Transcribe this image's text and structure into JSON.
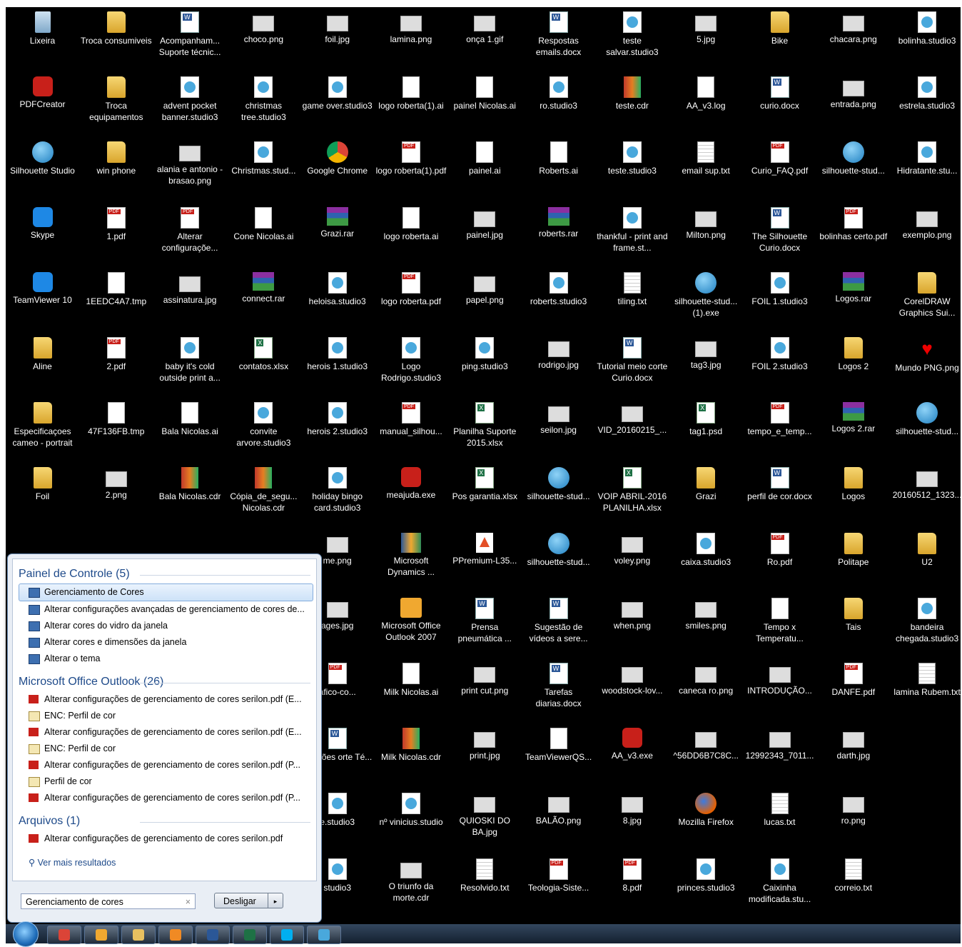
{
  "desktop": {
    "icons": [
      {
        "label": "Lixeira",
        "kind": "recycle",
        "icon": "recycle-bin-icon"
      },
      {
        "label": "Troca consumiveis",
        "kind": "folder",
        "icon": "folder-icon"
      },
      {
        "label": "Acompanham... Suporte técnic...",
        "kind": "word",
        "icon": "word-document-icon"
      },
      {
        "label": "choco.png",
        "kind": "img",
        "icon": "image-file-icon"
      },
      {
        "label": "foil.jpg",
        "kind": "img",
        "icon": "image-file-icon"
      },
      {
        "label": "lamina.png",
        "kind": "img",
        "icon": "image-file-icon"
      },
      {
        "label": "onça 1.gif",
        "kind": "img",
        "icon": "image-file-icon"
      },
      {
        "label": "Respostas emails.docx",
        "kind": "word",
        "icon": "word-document-icon"
      },
      {
        "label": "teste salvar.studio3",
        "kind": "studio",
        "icon": "studio3-file-icon"
      },
      {
        "label": "5.jpg",
        "kind": "img",
        "icon": "image-file-icon"
      },
      {
        "label": "Bike",
        "kind": "folder",
        "icon": "folder-icon"
      },
      {
        "label": "chacara.png",
        "kind": "img",
        "icon": "image-file-icon"
      },
      {
        "label": "bolinha.studio3",
        "kind": "studio",
        "icon": "studio3-file-icon"
      },
      {
        "label": "PDFCreator",
        "kind": "red",
        "icon": "pdfcreator-icon"
      },
      {
        "label": "Troca equipamentos",
        "kind": "folder",
        "icon": "folder-icon"
      },
      {
        "label": "advent pocket banner.studio3",
        "kind": "studio",
        "icon": "studio3-file-icon"
      },
      {
        "label": "christmas tree.studio3",
        "kind": "studio",
        "icon": "studio3-file-icon"
      },
      {
        "label": "game over.studio3",
        "kind": "studio",
        "icon": "studio3-file-icon"
      },
      {
        "label": "logo roberta(1).ai",
        "kind": "doc",
        "icon": "blank-file-icon"
      },
      {
        "label": "painel Nicolas.ai",
        "kind": "doc",
        "icon": "blank-file-icon"
      },
      {
        "label": "ro.studio3",
        "kind": "studio",
        "icon": "studio3-file-icon"
      },
      {
        "label": "teste.cdr",
        "kind": "cdr",
        "icon": "coreldraw-file-icon"
      },
      {
        "label": "AA_v3.log",
        "kind": "log",
        "icon": "log-file-icon"
      },
      {
        "label": "curio.docx",
        "kind": "word",
        "icon": "word-document-icon"
      },
      {
        "label": "entrada.png",
        "kind": "img",
        "icon": "image-file-icon"
      },
      {
        "label": "estrela.studio3",
        "kind": "studio",
        "icon": "studio3-file-icon"
      },
      {
        "label": "Silhouette Studio",
        "kind": "silh",
        "icon": "silhouette-studio-icon"
      },
      {
        "label": "win phone",
        "kind": "folder",
        "icon": "folder-icon"
      },
      {
        "label": "alania e antonio - brasao.png",
        "kind": "img",
        "icon": "image-file-icon"
      },
      {
        "label": "Christmas.stud...",
        "kind": "studio",
        "icon": "studio3-file-icon"
      },
      {
        "label": "Google Chrome",
        "kind": "chrome",
        "icon": "chrome-icon"
      },
      {
        "label": "logo roberta(1).pdf",
        "kind": "pdf",
        "icon": "pdf-file-icon"
      },
      {
        "label": "painel.ai",
        "kind": "doc",
        "icon": "blank-file-icon"
      },
      {
        "label": "Roberts.ai",
        "kind": "doc",
        "icon": "blank-file-icon"
      },
      {
        "label": "teste.studio3",
        "kind": "studio",
        "icon": "studio3-file-icon"
      },
      {
        "label": "email sup.txt",
        "kind": "txt",
        "icon": "text-file-icon"
      },
      {
        "label": "Curio_FAQ.pdf",
        "kind": "pdf",
        "icon": "pdf-file-icon"
      },
      {
        "label": "silhouette-stud...",
        "kind": "silh",
        "icon": "silhouette-studio-icon"
      },
      {
        "label": "Hidratante.stu...",
        "kind": "studio",
        "icon": "studio3-file-icon"
      },
      {
        "label": "Skype",
        "kind": "blue",
        "icon": "skype-icon"
      },
      {
        "label": "1.pdf",
        "kind": "pdf",
        "icon": "pdf-file-icon"
      },
      {
        "label": "Alterar configuraçõe...",
        "kind": "pdf",
        "icon": "pdf-file-icon"
      },
      {
        "label": "Cone Nicolas.ai",
        "kind": "doc",
        "icon": "blank-file-icon"
      },
      {
        "label": "Grazi.rar",
        "kind": "rar",
        "icon": "winrar-archive-icon"
      },
      {
        "label": "logo roberta.ai",
        "kind": "doc",
        "icon": "blank-file-icon"
      },
      {
        "label": "painel.jpg",
        "kind": "img",
        "icon": "image-file-icon"
      },
      {
        "label": "roberts.rar",
        "kind": "rar",
        "icon": "winrar-archive-icon"
      },
      {
        "label": "thankful - print and frame.st...",
        "kind": "studio",
        "icon": "studio3-file-icon"
      },
      {
        "label": "Milton.png",
        "kind": "img",
        "icon": "image-file-icon"
      },
      {
        "label": "The Silhouette Curio.docx",
        "kind": "word",
        "icon": "word-document-icon"
      },
      {
        "label": "bolinhas certo.pdf",
        "kind": "pdf",
        "icon": "pdf-file-icon"
      },
      {
        "label": "exemplo.png",
        "kind": "img",
        "icon": "image-file-icon"
      },
      {
        "label": "TeamViewer 10",
        "kind": "blue",
        "icon": "teamviewer-icon"
      },
      {
        "label": "1EEDC4A7.tmp",
        "kind": "doc",
        "icon": "blank-file-icon"
      },
      {
        "label": "assinatura.jpg",
        "kind": "img",
        "icon": "image-file-icon"
      },
      {
        "label": "connect.rar",
        "kind": "rar",
        "icon": "winrar-archive-icon"
      },
      {
        "label": "heloisa.studio3",
        "kind": "studio",
        "icon": "studio3-file-icon"
      },
      {
        "label": "logo roberta.pdf",
        "kind": "pdf",
        "icon": "pdf-file-icon"
      },
      {
        "label": "papel.png",
        "kind": "img",
        "icon": "image-file-icon"
      },
      {
        "label": "roberts.studio3",
        "kind": "studio",
        "icon": "studio3-file-icon"
      },
      {
        "label": "tiling.txt",
        "kind": "txt",
        "icon": "text-file-icon"
      },
      {
        "label": "silhouette-stud... (1).exe",
        "kind": "silh",
        "icon": "silhouette-studio-icon"
      },
      {
        "label": "FOIL 1.studio3",
        "kind": "studio",
        "icon": "studio3-file-icon"
      },
      {
        "label": "Logos.rar",
        "kind": "rar",
        "icon": "winrar-archive-icon"
      },
      {
        "label": "CorelDRAW Graphics Sui...",
        "kind": "folder",
        "icon": "folder-icon"
      },
      {
        "label": "Aline",
        "kind": "folder",
        "icon": "folder-icon"
      },
      {
        "label": "2.pdf",
        "kind": "pdf",
        "icon": "pdf-file-icon"
      },
      {
        "label": "baby it's cold outside print a...",
        "kind": "studio",
        "icon": "studio3-file-icon"
      },
      {
        "label": "contatos.xlsx",
        "kind": "excel",
        "icon": "excel-file-icon"
      },
      {
        "label": "herois 1.studio3",
        "kind": "studio",
        "icon": "studio3-file-icon"
      },
      {
        "label": "Logo Rodrigo.studio3",
        "kind": "studio",
        "icon": "studio3-file-icon"
      },
      {
        "label": "ping.studio3",
        "kind": "studio",
        "icon": "studio3-file-icon"
      },
      {
        "label": "rodrigo.jpg",
        "kind": "img",
        "icon": "image-file-icon"
      },
      {
        "label": "Tutorial meio corte Curio.docx",
        "kind": "word",
        "icon": "word-document-icon"
      },
      {
        "label": "tag3.jpg",
        "kind": "img",
        "icon": "image-file-icon"
      },
      {
        "label": "FOIL 2.studio3",
        "kind": "studio",
        "icon": "studio3-file-icon"
      },
      {
        "label": "Logos 2",
        "kind": "folder",
        "icon": "folder-icon"
      },
      {
        "label": "Mundo PNG.png",
        "kind": "heart",
        "icon": "heart-icon"
      },
      {
        "label": "Especificaçoes cameo - portrait",
        "kind": "folder",
        "icon": "folder-icon"
      },
      {
        "label": "47F136FB.tmp",
        "kind": "doc",
        "icon": "blank-file-icon"
      },
      {
        "label": "Bala Nicolas.ai",
        "kind": "doc",
        "icon": "blank-file-icon"
      },
      {
        "label": "convite arvore.studio3",
        "kind": "studio",
        "icon": "studio3-file-icon"
      },
      {
        "label": "herois 2.studio3",
        "kind": "studio",
        "icon": "studio3-file-icon"
      },
      {
        "label": "manual_silhou...",
        "kind": "pdf",
        "icon": "pdf-file-icon"
      },
      {
        "label": "Planilha Suporte 2015.xlsx",
        "kind": "excel",
        "icon": "excel-file-icon"
      },
      {
        "label": "seilon.jpg",
        "kind": "img",
        "icon": "image-file-icon"
      },
      {
        "label": "VID_20160215_...",
        "kind": "img",
        "icon": "video-file-icon"
      },
      {
        "label": "tag1.psd",
        "kind": "excel",
        "icon": "psd-file-icon"
      },
      {
        "label": "tempo_e_temp...",
        "kind": "pdf",
        "icon": "pdf-file-icon"
      },
      {
        "label": "Logos 2.rar",
        "kind": "rar",
        "icon": "winrar-archive-icon"
      },
      {
        "label": "silhouette-stud...",
        "kind": "silh",
        "icon": "silhouette-studio-icon"
      },
      {
        "label": "Foil",
        "kind": "folder",
        "icon": "folder-icon"
      },
      {
        "label": "2.png",
        "kind": "img",
        "icon": "image-file-icon"
      },
      {
        "label": "Bala Nicolas.cdr",
        "kind": "cdr",
        "icon": "coreldraw-file-icon"
      },
      {
        "label": "Cópia_de_segu... Nicolas.cdr",
        "kind": "cdr",
        "icon": "coreldraw-file-icon"
      },
      {
        "label": "holiday bingo card.studio3",
        "kind": "studio",
        "icon": "studio3-file-icon"
      },
      {
        "label": "meajuda.exe",
        "kind": "red",
        "icon": "exe-app-icon"
      },
      {
        "label": "Pos garantia.xlsx",
        "kind": "excel",
        "icon": "excel-file-icon"
      },
      {
        "label": "silhouette-stud...",
        "kind": "silh",
        "icon": "silhouette-studio-icon"
      },
      {
        "label": "VOIP ABRIL-2016 PLANILHA.xlsx",
        "kind": "excel",
        "icon": "excel-file-icon"
      },
      {
        "label": "Grazi",
        "kind": "folder",
        "icon": "folder-icon"
      },
      {
        "label": "perfil de cor.docx",
        "kind": "word",
        "icon": "word-document-icon"
      },
      {
        "label": "Logos",
        "kind": "folder",
        "icon": "folder-icon"
      },
      {
        "label": "20160512_1323...",
        "kind": "img",
        "icon": "image-file-icon"
      },
      {
        "label": "me.png",
        "kind": "img",
        "icon": "image-file-icon"
      },
      {
        "label": "Microsoft Dynamics ...",
        "kind": "dyn",
        "icon": "dynamics-icon"
      },
      {
        "label": "PPremium-L35...",
        "kind": "pp",
        "icon": "program-shortcut-icon"
      },
      {
        "label": "silhouette-stud...",
        "kind": "silh",
        "icon": "silhouette-studio-icon"
      },
      {
        "label": "voley.png",
        "kind": "img",
        "icon": "image-file-icon"
      },
      {
        "label": "caixa.studio3",
        "kind": "studio",
        "icon": "studio3-file-icon"
      },
      {
        "label": "Ro.pdf",
        "kind": "pdf",
        "icon": "pdf-file-icon"
      },
      {
        "label": "Politape",
        "kind": "folder",
        "icon": "folder-icon"
      },
      {
        "label": "U2",
        "kind": "folder",
        "icon": "folder-icon"
      },
      {
        "label": "ages.jpg",
        "kind": "img",
        "icon": "image-file-icon"
      },
      {
        "label": "Microsoft Office Outlook 2007",
        "kind": "outlook",
        "icon": "outlook-icon"
      },
      {
        "label": "Prensa pneumática ...",
        "kind": "word",
        "icon": "word-document-icon"
      },
      {
        "label": "Sugestão de vídeos a sere...",
        "kind": "word",
        "icon": "word-document-icon"
      },
      {
        "label": "when.png",
        "kind": "img",
        "icon": "image-file-icon"
      },
      {
        "label": "smiles.png",
        "kind": "img",
        "icon": "image-file-icon"
      },
      {
        "label": "Tempo x Temperatu...",
        "kind": "doc",
        "icon": "blank-file-icon"
      },
      {
        "label": "Tais",
        "kind": "folder",
        "icon": "folder-icon"
      },
      {
        "label": "bandeira chegada.studio3",
        "kind": "studio",
        "icon": "studio3-file-icon"
      },
      {
        "label": "afico-co...",
        "kind": "pdf",
        "icon": "pdf-file-icon"
      },
      {
        "label": "Milk Nicolas.ai",
        "kind": "doc",
        "icon": "blank-file-icon"
      },
      {
        "label": "print cut.png",
        "kind": "img",
        "icon": "image-file-icon"
      },
      {
        "label": "Tarefas diarias.docx",
        "kind": "word",
        "icon": "word-document-icon"
      },
      {
        "label": "woodstock-lov...",
        "kind": "img",
        "icon": "image-file-icon"
      },
      {
        "label": "caneca ro.png",
        "kind": "img",
        "icon": "image-file-icon"
      },
      {
        "label": "INTRODUÇÃO...",
        "kind": "img",
        "icon": "image-file-icon"
      },
      {
        "label": "DANFE.pdf",
        "kind": "pdf",
        "icon": "pdf-file-icon"
      },
      {
        "label": "lamina Rubem.txt",
        "kind": "txt",
        "icon": "text-file-icon"
      },
      {
        "label": "rmações orte Té...",
        "kind": "word",
        "icon": "word-document-icon"
      },
      {
        "label": "Milk Nicolas.cdr",
        "kind": "cdr",
        "icon": "coreldraw-file-icon"
      },
      {
        "label": "print.jpg",
        "kind": "img",
        "icon": "image-file-icon"
      },
      {
        "label": "TeamViewerQS...",
        "kind": "doc",
        "icon": "blank-file-icon"
      },
      {
        "label": "AA_v3.exe",
        "kind": "red",
        "icon": "exe-app-icon"
      },
      {
        "label": "^56DD6B7C8C...",
        "kind": "img",
        "icon": "image-file-icon"
      },
      {
        "label": "12992343_7011...",
        "kind": "img",
        "icon": "image-file-icon"
      },
      {
        "label": "darth.jpg",
        "kind": "img",
        "icon": "image-file-icon"
      },
      {
        "label": "e.studio3",
        "kind": "studio",
        "icon": "studio3-file-icon"
      },
      {
        "label": "nº vinicius.studio",
        "kind": "studio",
        "icon": "studio3-file-icon"
      },
      {
        "label": "QUIOSKI DO BA.jpg",
        "kind": "img",
        "icon": "image-file-icon"
      },
      {
        "label": "BALÃO.png",
        "kind": "img",
        "icon": "image-file-icon"
      },
      {
        "label": "8.jpg",
        "kind": "img",
        "icon": "image-file-icon"
      },
      {
        "label": "Mozilla Firefox",
        "kind": "firefox",
        "icon": "firefox-icon"
      },
      {
        "label": "lucas.txt",
        "kind": "txt",
        "icon": "text-file-icon"
      },
      {
        "label": "ro.png",
        "kind": "img",
        "icon": "image-file-icon"
      },
      {
        "label": "studio3",
        "kind": "studio",
        "icon": "studio3-file-icon"
      },
      {
        "label": "O triunfo da morte.cdr",
        "kind": "img",
        "icon": "coreldraw-file-icon"
      },
      {
        "label": "Resolvido.txt",
        "kind": "txt",
        "icon": "text-file-icon"
      },
      {
        "label": "Teologia-Siste...",
        "kind": "pdf",
        "icon": "pdf-file-icon"
      },
      {
        "label": "8.pdf",
        "kind": "pdf",
        "icon": "pdf-file-icon"
      },
      {
        "label": "princes.studio3",
        "kind": "studio",
        "icon": "studio3-file-icon"
      },
      {
        "label": "Caixinha modificada.stu...",
        "kind": "studio",
        "icon": "studio3-file-icon"
      },
      {
        "label": "correio.txt",
        "kind": "txt",
        "icon": "text-file-icon"
      }
    ]
  },
  "start_menu": {
    "groups": [
      {
        "title": "Painel de Controle (5)",
        "kind": "cp",
        "items": [
          "Gerenciamento de Cores",
          "Alterar configurações avançadas de gerenciamento de cores de...",
          "Alterar cores do vidro da janela",
          "Alterar cores e dimensões da janela",
          "Alterar o tema"
        ]
      },
      {
        "title": "Microsoft Office Outlook (26)",
        "kind": "mail",
        "items": [
          "Alterar configurações de gerenciamento de cores serilon.pdf (E...",
          "ENC: Perfil de cor",
          "Alterar configurações de gerenciamento de cores serilon.pdf (E...",
          "ENC: Perfil de cor",
          "Alterar configurações de gerenciamento de cores serilon.pdf (P...",
          "Perfil de cor",
          "Alterar configurações de gerenciamento de cores serilon.pdf (P..."
        ]
      },
      {
        "title": "Arquivos (1)",
        "kind": "pdf",
        "items": [
          "Alterar configurações de gerenciamento de cores serilon.pdf"
        ]
      }
    ],
    "selected_item": "Gerenciamento de Cores",
    "more_results": "Ver mais resultados",
    "search_value": "Gerenciamento de cores",
    "clear_glyph": "×",
    "shutdown_label": "Desligar",
    "shutdown_arrow": "▸"
  },
  "taskbar": {
    "pinned": [
      {
        "name": "chrome-taskbar-button",
        "color": "#db4437"
      },
      {
        "name": "outlook-taskbar-button",
        "color": "#f0a830"
      },
      {
        "name": "explorer-taskbar-button",
        "color": "#e8c060"
      },
      {
        "name": "media-player-taskbar-button",
        "color": "#f08a24"
      },
      {
        "name": "word-taskbar-button",
        "color": "#2b5797"
      },
      {
        "name": "excel-taskbar-button",
        "color": "#1e7145"
      },
      {
        "name": "skype-taskbar-button",
        "color": "#00aff0"
      },
      {
        "name": "silhouette-taskbar-button",
        "color": "#49a8dc"
      }
    ]
  }
}
